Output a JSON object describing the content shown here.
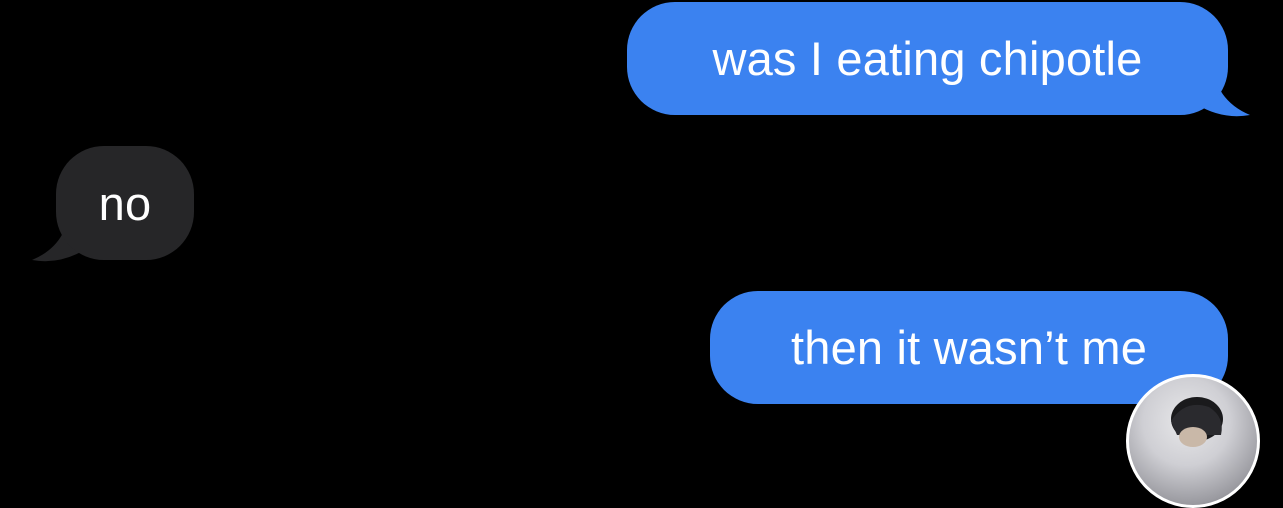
{
  "conversation": {
    "messages": [
      {
        "direction": "sent",
        "text": "was I eating chipotle"
      },
      {
        "direction": "received",
        "text": "no"
      },
      {
        "direction": "sent",
        "text": "then it wasn’t me"
      }
    ]
  },
  "colors": {
    "background": "#000000",
    "sent_bubble": "#3b82f0",
    "received_bubble": "#262628",
    "text": "#ffffff"
  },
  "icons": {
    "avatar": "contact-avatar"
  }
}
